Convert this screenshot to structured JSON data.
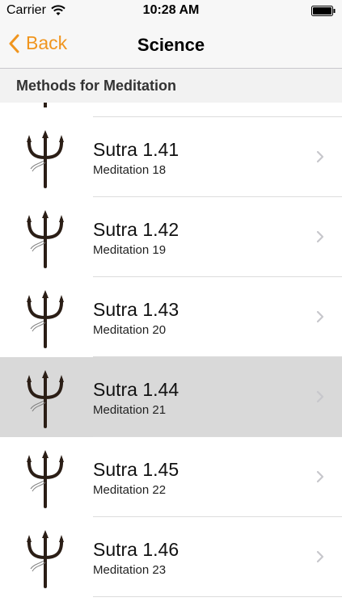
{
  "status_bar": {
    "carrier": "Carrier",
    "time": "10:28 AM"
  },
  "nav": {
    "back_label": "Back",
    "title": "Science",
    "accent_color": "#f0951e"
  },
  "section": {
    "header": "Methods for Meditation"
  },
  "rows": [
    {
      "title": "Sutra 1.41",
      "subtitle": "Meditation 18",
      "selected": false
    },
    {
      "title": "Sutra 1.42",
      "subtitle": "Meditation 19",
      "selected": false
    },
    {
      "title": "Sutra 1.43",
      "subtitle": "Meditation 20",
      "selected": false
    },
    {
      "title": "Sutra 1.44",
      "subtitle": "Meditation 21",
      "selected": true
    },
    {
      "title": "Sutra 1.45",
      "subtitle": "Meditation 22",
      "selected": false
    },
    {
      "title": "Sutra 1.46",
      "subtitle": "Meditation 23",
      "selected": false
    }
  ],
  "icons": {
    "row_thumbnail": "trident-icon",
    "disclosure": "chevron-right-icon",
    "back": "chevron-left-icon"
  }
}
